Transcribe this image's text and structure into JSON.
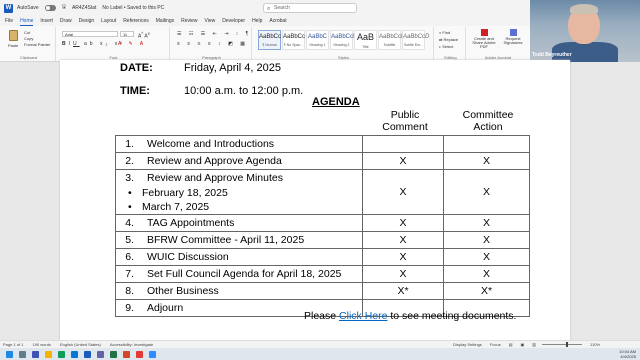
{
  "titlebar": {
    "autosave_label": "AutoSave",
    "toggle_state": "Off",
    "filename": "AR4Z4Stat",
    "label_status": "No Label • Saved to this PC",
    "search_placeholder": "Search"
  },
  "menu": {
    "tabs": [
      "File",
      "Home",
      "Insert",
      "Draw",
      "Design",
      "Layout",
      "References",
      "Mailings",
      "Review",
      "View",
      "Developer",
      "Help",
      "Acrobat"
    ],
    "active": "Home"
  },
  "ribbon": {
    "paste_label": "Paste",
    "cut_label": "Cut",
    "copy_label": "Copy",
    "format_painter_label": "Format Painter",
    "clipboard_group": "Clipboard",
    "font_name": "Arial",
    "font_size": "11",
    "font_group": "Font",
    "paragraph_group": "Paragraph",
    "styles": [
      {
        "sample": "AaBbCc",
        "name": "¶ Normal"
      },
      {
        "sample": "AaBbCc",
        "name": "¶ No Spac..."
      },
      {
        "sample": "AaBbC",
        "name": "Heading 1"
      },
      {
        "sample": "AaBbCcI",
        "name": "Heading 2"
      },
      {
        "sample": "AaB",
        "name": "Title"
      },
      {
        "sample": "AaBbCcD",
        "name": "Subtitle"
      },
      {
        "sample": "AaBbCcD",
        "name": "Subtle Em..."
      }
    ],
    "styles_group": "Styles",
    "find_label": "Find",
    "replace_label": "Replace",
    "select_label": "Select",
    "editing_group": "Editing",
    "create_pdf_label": "Create and Share Adobe PDF",
    "request_sig_label": "Request Signatures",
    "acrobat_group": "Adobe Acrobat"
  },
  "webcam": {
    "name": "Todd Beyreuther"
  },
  "document": {
    "date_label": "DATE:",
    "date_value": "Friday, April 4, 2025",
    "time_label": "TIME:",
    "time_value": "10:00 a.m. to 12:00 p.m.",
    "agenda_title": "AGENDA",
    "col_public_1": "Public",
    "col_public_2": "Comment",
    "col_committee_1": "Committee",
    "col_committee_2": "Action",
    "items": [
      {
        "num": "1.",
        "text": "Welcome and Introductions",
        "public": "",
        "committee": ""
      },
      {
        "num": "2.",
        "text": "Review and Approve Agenda",
        "public": "X",
        "committee": "X"
      },
      {
        "num": "3.",
        "text": "Review and Approve Minutes",
        "public": "X",
        "committee": "X",
        "subitems": [
          "February 18, 2025",
          "March 7, 2025"
        ]
      },
      {
        "num": "4.",
        "text": "TAG Appointments",
        "public": "X",
        "committee": "X"
      },
      {
        "num": "5.",
        "text": "BFRW Committee - April 11, 2025",
        "public": "X",
        "committee": "X"
      },
      {
        "num": "6.",
        "text": "WUIC Discussion",
        "public": "X",
        "committee": "X"
      },
      {
        "num": "7.",
        "text": "Set Full Council Agenda for April 18, 2025",
        "public": "X",
        "committee": "X"
      },
      {
        "num": "8.",
        "text": "Other Business",
        "public": "X*",
        "committee": "X*"
      },
      {
        "num": "9.",
        "text": "Adjourn",
        "public": "",
        "committee": ""
      }
    ],
    "footnote_before": "Please ",
    "footnote_link": "Click Here",
    "footnote_after": " to see meeting documents."
  },
  "statusbar": {
    "page": "Page 1 of 1",
    "words": "190 words",
    "language": "English (United States)",
    "accessibility": "Accessibility: Investigate",
    "display_settings": "Display Settings",
    "focus": "Focus",
    "zoom": "110%"
  },
  "tray": {
    "time": "10:04 AM",
    "date": "4/4/2025"
  }
}
